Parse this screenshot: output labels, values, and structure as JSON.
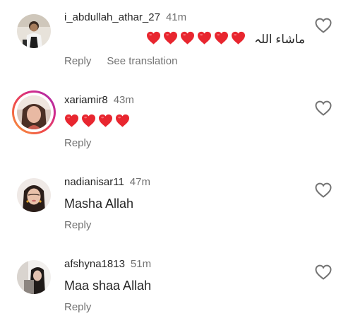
{
  "colors": {
    "text_primary": "#262626",
    "text_secondary": "#737373",
    "emoji_heart": "#e8262f",
    "story_ring": "gradient-orange-pink-purple"
  },
  "icons": {
    "like": "heart-outline-icon",
    "emoji": "red-heart-emoji"
  },
  "comments": [
    {
      "username": "i_abdullah_athar_27",
      "time": "41m",
      "text": "ماشاء اللہ",
      "heart_emojis": 6,
      "reply_label": "Reply",
      "translation_label": "See translation",
      "has_story_ring": false
    },
    {
      "username": "xariamir8",
      "time": "43m",
      "text": "",
      "heart_emojis": 4,
      "reply_label": "Reply",
      "has_story_ring": true
    },
    {
      "username": "nadianisar11",
      "time": "47m",
      "text": "Masha Allah",
      "heart_emojis": 0,
      "reply_label": "Reply",
      "has_story_ring": false
    },
    {
      "username": "afshyna1813",
      "time": "51m",
      "text": "Maa shaa Allah",
      "heart_emojis": 0,
      "reply_label": "Reply",
      "has_story_ring": false
    }
  ]
}
